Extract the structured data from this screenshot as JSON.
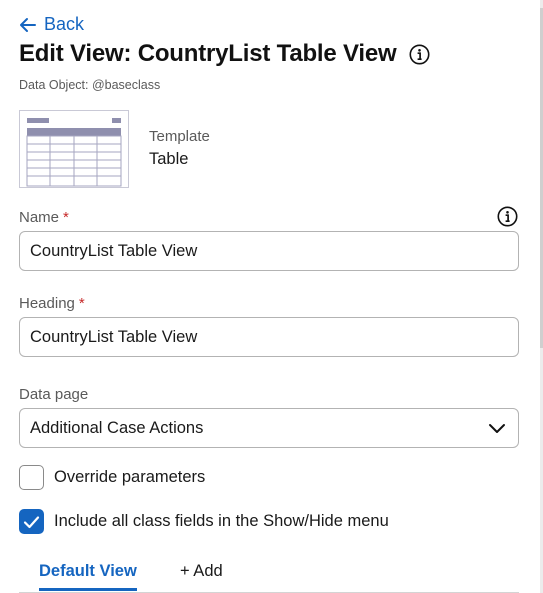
{
  "header": {
    "back_label": "Back",
    "title": "Edit View: CountryList Table View",
    "subtitle": "Data Object: @baseclass"
  },
  "template": {
    "label": "Template",
    "value": "Table"
  },
  "fields": {
    "name": {
      "label": "Name",
      "required_mark": "*",
      "value": "CountryList Table View"
    },
    "heading": {
      "label": "Heading",
      "required_mark": "*",
      "value": "CountryList Table View"
    },
    "data_page": {
      "label": "Data page",
      "value": "Additional Case Actions"
    }
  },
  "options": {
    "override_parameters": {
      "label": "Override parameters",
      "checked": false
    },
    "include_class_fields": {
      "label": "Include all class fields in the Show/Hide menu",
      "checked": true
    }
  },
  "tabs": {
    "default_view": "Default View",
    "add": "+ Add"
  },
  "colors": {
    "accent": "#1565c0",
    "required": "#c62828",
    "thumb_header": "#8f8fae"
  },
  "icons": {
    "back": "arrow-left-icon",
    "info": "info-circle-icon",
    "dropdown": "chevron-down-icon",
    "check": "checkmark-icon"
  }
}
